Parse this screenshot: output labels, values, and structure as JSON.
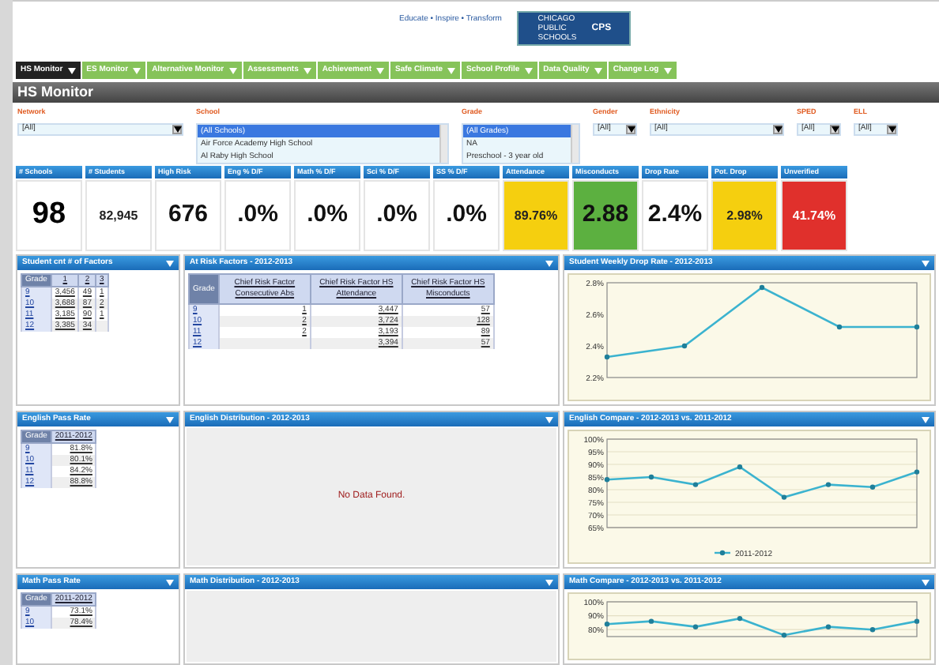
{
  "header": {
    "tagline": "Educate • Inspire • Transform",
    "logo_small": "CHICAGO PUBLIC SCHOOLS",
    "logo_big": "CPS"
  },
  "nav": [
    {
      "label": "HS Monitor",
      "selected": true
    },
    {
      "label": "ES Monitor",
      "selected": false
    },
    {
      "label": "Alternative Monitor",
      "selected": false
    },
    {
      "label": "Assessments",
      "selected": false
    },
    {
      "label": "Achievement",
      "selected": false
    },
    {
      "label": "Safe Climate",
      "selected": false
    },
    {
      "label": "School Profile",
      "selected": false
    },
    {
      "label": "Data Quality",
      "selected": false
    },
    {
      "label": "Change Log",
      "selected": false
    }
  ],
  "page_title": "HS Monitor",
  "filters": [
    {
      "kind": "dropdown",
      "label": "Network",
      "value": "[All]"
    },
    {
      "kind": "list",
      "label": "School",
      "options": [
        {
          "label": "(All Schools)",
          "selected": true
        },
        {
          "label": "Air Force Academy High School",
          "selected": false
        },
        {
          "label": "Al Raby High School",
          "selected": false
        }
      ]
    },
    {
      "kind": "list",
      "label": "Grade",
      "options": [
        {
          "label": "(All Grades)",
          "selected": true
        },
        {
          "label": "NA",
          "selected": false
        },
        {
          "label": "Preschool - 3 year old",
          "selected": false
        }
      ]
    },
    {
      "kind": "dropdown",
      "label": "Gender",
      "value": "[All]"
    },
    {
      "kind": "dropdown",
      "label": "Ethnicity",
      "value": "[All]"
    },
    {
      "kind": "dropdown",
      "label": "SPED",
      "value": "[All]"
    },
    {
      "kind": "dropdown",
      "label": "ELL",
      "value": "[All]"
    }
  ],
  "kpis": [
    {
      "label": "# Schools",
      "value": "98",
      "color": "#ffffff"
    },
    {
      "label": "# Students",
      "value": "82,945",
      "color": "#ffffff"
    },
    {
      "label": "High Risk",
      "value": "676",
      "color": "#ffffff"
    },
    {
      "label": "Eng % D/F",
      "value": ".0%",
      "color": "#ffffff"
    },
    {
      "label": "Math % D/F",
      "value": ".0%",
      "color": "#ffffff"
    },
    {
      "label": "Sci % D/F",
      "value": ".0%",
      "color": "#ffffff"
    },
    {
      "label": "SS % D/F",
      "value": ".0%",
      "color": "#ffffff"
    },
    {
      "label": "Attendance",
      "value": "89.76%",
      "color": "#f5cf0f"
    },
    {
      "label": "Misconducts",
      "value": "2.88",
      "color": "#5cb040"
    },
    {
      "label": "Drop Rate",
      "value": "2.4%",
      "color": "#ffffff"
    },
    {
      "label": "Pot. Drop",
      "value": "2.98%",
      "color": "#f5cf0f"
    },
    {
      "label": "Unverified",
      "value": "41.74%",
      "color": "#e0302c"
    }
  ],
  "rows": [
    {
      "panels": [
        {
          "kind": "table",
          "title": "Student cnt # of Factors",
          "table": {
            "columns": [
              "Grade",
              "1",
              "2",
              "3"
            ],
            "rows": [
              [
                "9",
                "3,456",
                "49",
                "1"
              ],
              [
                "10",
                "3,688",
                "87",
                "2"
              ],
              [
                "11",
                "3,185",
                "90",
                "1"
              ],
              [
                "12",
                "3,385",
                "34",
                ""
              ]
            ]
          }
        },
        {
          "kind": "table",
          "title": "At Risk Factors - 2012-2013",
          "table": {
            "columns": [
              "Grade",
              "Chief Risk Factor Consecutive Abs",
              "Chief Risk Factor HS Attendance",
              "Chief Risk Factor HS Misconducts"
            ],
            "rows": [
              [
                "9",
                "1",
                "3,447",
                "57"
              ],
              [
                "10",
                "2",
                "3,724",
                "128"
              ],
              [
                "11",
                "2",
                "3,193",
                "89"
              ],
              [
                "12",
                "",
                "3,394",
                "57"
              ]
            ]
          }
        },
        {
          "kind": "chart",
          "title": "Student Weekly Drop Rate - 2012-2013",
          "chart_data": {
            "type": "line",
            "series": [
              {
                "color": "#3bb3cf",
                "marker": "circle",
                "values": [
                  2.33,
                  2.4,
                  2.77,
                  2.52,
                  2.52
                ]
              }
            ],
            "grid": false,
            "ylim": [
              2.2,
              2.8
            ],
            "yticks": [
              {
                "value": 2.2,
                "label": "2.2%"
              },
              {
                "value": 2.4,
                "label": "2.4%"
              },
              {
                "value": 2.6,
                "label": "2.6%"
              },
              {
                "value": 2.8,
                "label": "2.8%"
              }
            ]
          }
        }
      ]
    },
    {
      "panels": [
        {
          "kind": "table",
          "title": "English Pass Rate",
          "table": {
            "columns": [
              "Grade",
              "2011-2012"
            ],
            "rows": [
              [
                "9",
                "81.8%"
              ],
              [
                "10",
                "80.1%"
              ],
              [
                "11",
                "84.2%"
              ],
              [
                "12",
                "88.8%"
              ]
            ]
          }
        },
        {
          "kind": "empty",
          "title": "English Distribution - 2012-2013",
          "message": "No Data Found."
        },
        {
          "kind": "chart",
          "title": "English Compare - 2012-2013 vs. 2011-2012",
          "chart_data": {
            "type": "line",
            "series": [
              {
                "name": "2011-2012",
                "color": "#3bb3cf",
                "marker": "circle",
                "values": [
                  84,
                  85,
                  82,
                  89,
                  77,
                  82,
                  81,
                  87
                ]
              }
            ],
            "grid": true,
            "ylim": [
              65,
              100
            ],
            "yticks": [
              {
                "value": 65,
                "label": "65%"
              },
              {
                "value": 70,
                "label": "70%"
              },
              {
                "value": 75,
                "label": "75%"
              },
              {
                "value": 80,
                "label": "80%"
              },
              {
                "value": 85,
                "label": "85%"
              },
              {
                "value": 90,
                "label": "90%"
              },
              {
                "value": 95,
                "label": "95%"
              },
              {
                "value": 100,
                "label": "100%"
              }
            ]
          }
        }
      ]
    },
    {
      "panels": [
        {
          "kind": "table",
          "title": "Math Pass Rate",
          "table": {
            "columns": [
              "Grade",
              "2011-2012"
            ],
            "rows": [
              [
                "9",
                "73.1%"
              ],
              [
                "10",
                "78.4%"
              ]
            ]
          }
        },
        {
          "kind": "empty",
          "title": "Math Distribution - 2012-2013"
        },
        {
          "kind": "chart",
          "title": "Math Compare - 2012-2013 vs. 2011-2012",
          "chart_data": {
            "type": "line",
            "series": [
              {
                "color": "#3bb3cf",
                "marker": "circle",
                "values": [
                  84,
                  86,
                  82,
                  88,
                  76,
                  82,
                  80,
                  86
                ]
              }
            ],
            "grid": true,
            "ylim": [
              75,
              100
            ],
            "yticks": [
              {
                "value": 80,
                "label": "80%"
              },
              {
                "value": 90,
                "label": "90%"
              },
              {
                "value": 100,
                "label": "100%"
              }
            ]
          }
        }
      ]
    }
  ]
}
